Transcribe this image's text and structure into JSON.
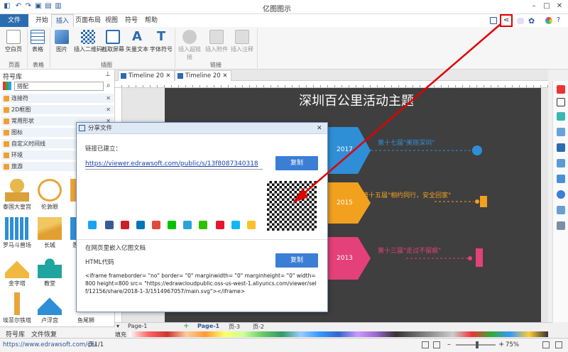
{
  "app": {
    "title": "亿图图示"
  },
  "ribbon": {
    "tabs": [
      "文件",
      "开始",
      "插入",
      "页面布局",
      "视图",
      "符号",
      "帮助"
    ],
    "buttons": {
      "blank_page": "空白页",
      "table": "表格",
      "picture": "图片",
      "qr_code": "插入二维码",
      "screenshot": "截取屏幕",
      "vector_text": "矢量文本",
      "font_symbol": "字体符号",
      "hyperlink": "插入超链接",
      "attachment": "插入附件",
      "comment": "插入注释"
    },
    "groups": {
      "page": "页面",
      "table": "表格",
      "illustration": "插图",
      "link": "链接"
    }
  },
  "sidebar": {
    "title": "符号库",
    "search_value": "搭配",
    "categories": [
      "连接符",
      "2D框图",
      "常用形状",
      "图标",
      "自定义时间线",
      "环境",
      "旅游"
    ],
    "symbols": [
      "泰国大皇宫",
      "伦敦眼",
      "",
      "罗马斗兽场",
      "长城",
      "悉",
      "金字塔",
      "教堂",
      "",
      "埃菲尔铁塔",
      "卢浮宫",
      "鱼尾狮"
    ],
    "bottom_tabs": [
      "符号库",
      "文件恢复"
    ]
  },
  "doc_tabs": [
    "Timeline 20",
    "Timeline 20"
  ],
  "canvas": {
    "title": "深圳百公里活动主题",
    "years": [
      "2017",
      "2015",
      "2013"
    ],
    "events": [
      "第十七届\"美丽深圳\"",
      "第十五届\"相约同行，安全回家\"",
      "第十三届\"走过不留痕\""
    ],
    "colors": {
      "bg": "#3f3f3f",
      "blue": "#2f8fd6",
      "orange": "#f2a11f",
      "pink": "#e4407a"
    }
  },
  "dialog": {
    "title": "分享文件",
    "link_label": "链接已建立：",
    "link_url": "https://viewer.edrawsoft.com/public/s/13f8087340318",
    "copy": "复制",
    "embed_label": "在网页里嵌入亿图文档",
    "html_label": "HTML代码",
    "html_code": "<iframe frameborder= \"no\" border= \"0\" marginwidth= \"0\" marginheight= \"0\" width=800 height=800 src= \"https://edrawcloudpublic.oss-us-west-1.aliyuncs.com/viewer/self/12156/share/2018-1-3/1514967057/main.svg\"></iframe>"
  },
  "pages": {
    "current": "Page-1",
    "tabs": [
      "Page-1",
      "页-3",
      "页-2"
    ],
    "fill_label": "填充"
  },
  "status": {
    "url": "https://www.edrawsoft.com/cn/",
    "page": "页1/1",
    "zoom": "75%"
  },
  "accent": "#2b579a",
  "annotation_color": "#e00000"
}
